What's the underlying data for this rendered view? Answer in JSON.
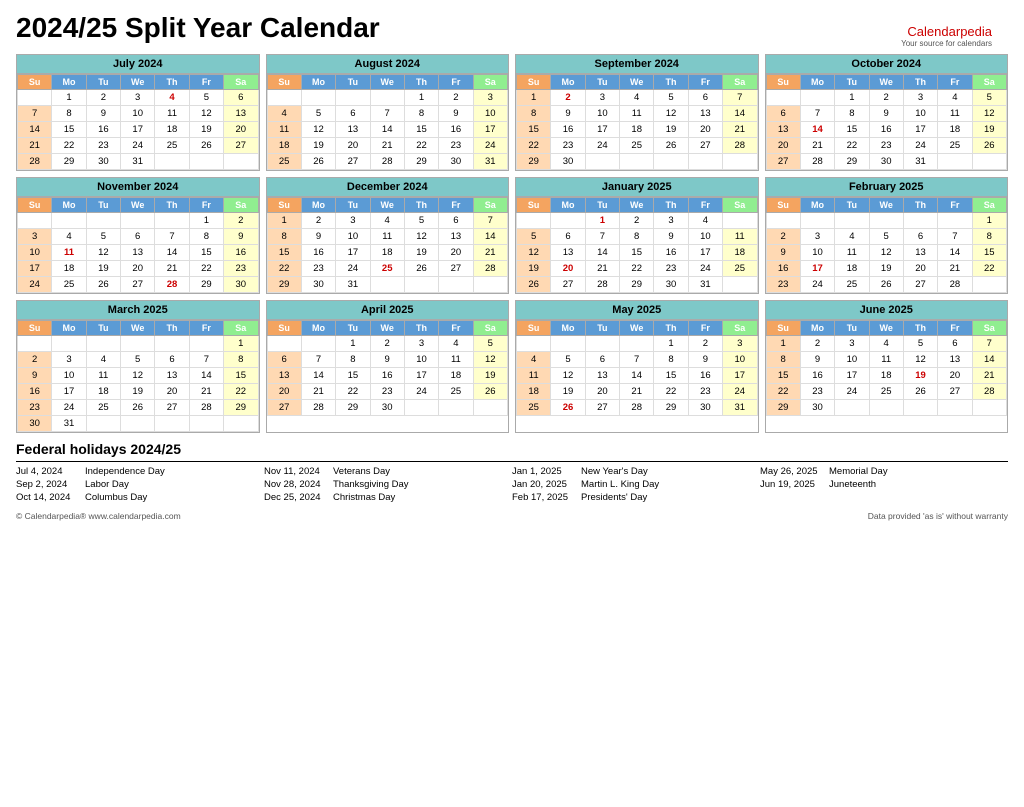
{
  "page": {
    "title": "2024/25 Split Year Calendar"
  },
  "brand": {
    "name1": "Calendar",
    "name2": "pedia",
    "tagline": "Your source for calendars"
  },
  "months": [
    {
      "name": "July 2024",
      "startDay": 1,
      "days": 31,
      "rows": [
        [
          "",
          "1",
          "2",
          "3",
          "4",
          "5",
          "6"
        ],
        [
          "7",
          "8",
          "9",
          "10",
          "11",
          "12",
          "13"
        ],
        [
          "14",
          "15",
          "16",
          "17",
          "18",
          "19",
          "20"
        ],
        [
          "21",
          "22",
          "23",
          "24",
          "25",
          "26",
          "27"
        ],
        [
          "28",
          "29",
          "30",
          "31",
          "",
          "",
          ""
        ]
      ],
      "redDays": [
        "4"
      ],
      "satCols": [
        6
      ],
      "sunCols": [
        0
      ]
    },
    {
      "name": "August 2024",
      "startDay": 4,
      "days": 31,
      "rows": [
        [
          "",
          "",
          "",
          "",
          "1",
          "2",
          "3"
        ],
        [
          "4",
          "5",
          "6",
          "7",
          "8",
          "9",
          "10"
        ],
        [
          "11",
          "12",
          "13",
          "14",
          "15",
          "16",
          "17"
        ],
        [
          "18",
          "19",
          "20",
          "21",
          "22",
          "23",
          "24"
        ],
        [
          "25",
          "26",
          "27",
          "28",
          "29",
          "30",
          "31"
        ]
      ],
      "redDays": [],
      "satCols": [
        6
      ],
      "sunCols": [
        0
      ]
    },
    {
      "name": "September 2024",
      "startDay": 0,
      "days": 30,
      "rows": [
        [
          "1",
          "2",
          "3",
          "4",
          "5",
          "6",
          "7"
        ],
        [
          "8",
          "9",
          "10",
          "11",
          "12",
          "13",
          "14"
        ],
        [
          "15",
          "16",
          "17",
          "18",
          "19",
          "20",
          "21"
        ],
        [
          "22",
          "23",
          "24",
          "25",
          "26",
          "27",
          "28"
        ],
        [
          "29",
          "30",
          "",
          "",
          "",
          "",
          ""
        ]
      ],
      "redDays": [
        "2"
      ],
      "satCols": [
        6
      ],
      "sunCols": [
        0
      ]
    },
    {
      "name": "October 2024",
      "startDay": 2,
      "days": 31,
      "rows": [
        [
          "",
          "",
          "1",
          "2",
          "3",
          "4",
          "5"
        ],
        [
          "6",
          "7",
          "8",
          "9",
          "10",
          "11",
          "12"
        ],
        [
          "13",
          "14",
          "15",
          "16",
          "17",
          "18",
          "19"
        ],
        [
          "20",
          "21",
          "22",
          "23",
          "24",
          "25",
          "26"
        ],
        [
          "27",
          "28",
          "29",
          "30",
          "31",
          "",
          ""
        ]
      ],
      "redDays": [
        "14"
      ],
      "satCols": [
        6
      ],
      "sunCols": [
        0
      ]
    },
    {
      "name": "November 2024",
      "startDay": 5,
      "days": 30,
      "rows": [
        [
          "",
          "",
          "",
          "",
          "",
          "1",
          "2"
        ],
        [
          "3",
          "4",
          "5",
          "6",
          "7",
          "8",
          "9"
        ],
        [
          "10",
          "11",
          "12",
          "13",
          "14",
          "15",
          "16"
        ],
        [
          "17",
          "18",
          "19",
          "20",
          "21",
          "22",
          "23"
        ],
        [
          "24",
          "25",
          "26",
          "27",
          "28",
          "29",
          "30"
        ]
      ],
      "redDays": [
        "11",
        "28"
      ],
      "satCols": [
        6
      ],
      "sunCols": [
        0
      ]
    },
    {
      "name": "December 2024",
      "startDay": 0,
      "days": 31,
      "rows": [
        [
          "1",
          "2",
          "3",
          "4",
          "5",
          "6",
          "7"
        ],
        [
          "8",
          "9",
          "10",
          "11",
          "12",
          "13",
          "14"
        ],
        [
          "15",
          "16",
          "17",
          "18",
          "19",
          "20",
          "21"
        ],
        [
          "22",
          "23",
          "24",
          "25",
          "26",
          "27",
          "28"
        ],
        [
          "29",
          "30",
          "31",
          "",
          "",
          "",
          ""
        ]
      ],
      "redDays": [
        "25"
      ],
      "satCols": [
        6
      ],
      "sunCols": [
        0
      ]
    },
    {
      "name": "January 2025",
      "startDay": 3,
      "days": 31,
      "rows": [
        [
          "",
          "",
          "1",
          "2",
          "3",
          "4",
          ""
        ],
        [
          "5",
          "6",
          "7",
          "8",
          "9",
          "10",
          "11"
        ],
        [
          "12",
          "13",
          "14",
          "15",
          "16",
          "17",
          "18"
        ],
        [
          "19",
          "20",
          "21",
          "22",
          "23",
          "24",
          "25"
        ],
        [
          "26",
          "27",
          "28",
          "29",
          "30",
          "31",
          ""
        ]
      ],
      "redDays": [
        "1",
        "20"
      ],
      "satCols": [
        6
      ],
      "sunCols": [
        0
      ]
    },
    {
      "name": "February 2025",
      "startDay": 6,
      "days": 28,
      "rows": [
        [
          "",
          "",
          "",
          "",
          "",
          "",
          "1"
        ],
        [
          "2",
          "3",
          "4",
          "5",
          "6",
          "7",
          "8"
        ],
        [
          "9",
          "10",
          "11",
          "12",
          "13",
          "14",
          "15"
        ],
        [
          "16",
          "17",
          "18",
          "19",
          "20",
          "21",
          "22"
        ],
        [
          "23",
          "24",
          "25",
          "26",
          "27",
          "28",
          ""
        ]
      ],
      "redDays": [
        "17"
      ],
      "satCols": [
        6
      ],
      "sunCols": [
        0
      ]
    },
    {
      "name": "March 2025",
      "startDay": 6,
      "days": 31,
      "rows": [
        [
          "",
          "",
          "",
          "",
          "",
          "",
          "1"
        ],
        [
          "2",
          "3",
          "4",
          "5",
          "6",
          "7",
          "8"
        ],
        [
          "9",
          "10",
          "11",
          "12",
          "13",
          "14",
          "15"
        ],
        [
          "16",
          "17",
          "18",
          "19",
          "20",
          "21",
          "22"
        ],
        [
          "23",
          "24",
          "25",
          "26",
          "27",
          "28",
          "29"
        ],
        [
          "30",
          "31",
          "",
          "",
          "",
          "",
          ""
        ]
      ],
      "redDays": [],
      "satCols": [
        6
      ],
      "sunCols": [
        0
      ]
    },
    {
      "name": "April 2025",
      "startDay": 2,
      "days": 30,
      "rows": [
        [
          "",
          "",
          "1",
          "2",
          "3",
          "4",
          "5"
        ],
        [
          "6",
          "7",
          "8",
          "9",
          "10",
          "11",
          "12"
        ],
        [
          "13",
          "14",
          "15",
          "16",
          "17",
          "18",
          "19"
        ],
        [
          "20",
          "21",
          "22",
          "23",
          "24",
          "25",
          "26"
        ],
        [
          "27",
          "28",
          "29",
          "30",
          "",
          "",
          ""
        ]
      ],
      "redDays": [],
      "satCols": [
        6
      ],
      "sunCols": [
        0
      ]
    },
    {
      "name": "May 2025",
      "startDay": 4,
      "days": 31,
      "rows": [
        [
          "",
          "",
          "",
          "",
          "1",
          "2",
          "3"
        ],
        [
          "4",
          "5",
          "6",
          "7",
          "8",
          "9",
          "10"
        ],
        [
          "11",
          "12",
          "13",
          "14",
          "15",
          "16",
          "17"
        ],
        [
          "18",
          "19",
          "20",
          "21",
          "22",
          "23",
          "24"
        ],
        [
          "25",
          "26",
          "27",
          "28",
          "29",
          "30",
          "31"
        ]
      ],
      "redDays": [
        "26"
      ],
      "satCols": [
        6
      ],
      "sunCols": [
        0
      ]
    },
    {
      "name": "June 2025",
      "startDay": 0,
      "days": 30,
      "rows": [
        [
          "1",
          "2",
          "3",
          "4",
          "5",
          "6",
          "7"
        ],
        [
          "8",
          "9",
          "10",
          "11",
          "12",
          "13",
          "14"
        ],
        [
          "15",
          "16",
          "17",
          "18",
          "19",
          "20",
          "21"
        ],
        [
          "22",
          "23",
          "24",
          "25",
          "26",
          "27",
          "28"
        ],
        [
          "29",
          "30",
          "",
          "",
          "",
          "",
          ""
        ]
      ],
      "redDays": [
        "19"
      ],
      "satCols": [
        6
      ],
      "sunCols": [
        0
      ]
    }
  ],
  "weekdays": [
    "Su",
    "Mo",
    "Tu",
    "We",
    "Th",
    "Fr",
    "Sa"
  ],
  "holidays": {
    "title": "Federal holidays 2024/25",
    "columns": [
      [
        {
          "date": "Jul 4, 2024",
          "name": "Independence Day"
        },
        {
          "date": "Sep 2, 2024",
          "name": "Labor Day"
        },
        {
          "date": "Oct 14, 2024",
          "name": "Columbus Day"
        }
      ],
      [
        {
          "date": "Nov 11, 2024",
          "name": "Veterans Day"
        },
        {
          "date": "Nov 28, 2024",
          "name": "Thanksgiving Day"
        },
        {
          "date": "Dec 25, 2024",
          "name": "Christmas Day"
        }
      ],
      [
        {
          "date": "Jan 1, 2025",
          "name": "New Year's Day"
        },
        {
          "date": "Jan 20, 2025",
          "name": "Martin L. King Day"
        },
        {
          "date": "Feb 17, 2025",
          "name": "Presidents' Day"
        }
      ],
      [
        {
          "date": "May 26, 2025",
          "name": "Memorial Day"
        },
        {
          "date": "Jun 19, 2025",
          "name": "Juneteenth"
        },
        {
          "date": "",
          "name": ""
        }
      ]
    ]
  },
  "footer": {
    "left": "© Calendarpedia®   www.calendarpedia.com",
    "right": "Data provided 'as is' without warranty"
  }
}
